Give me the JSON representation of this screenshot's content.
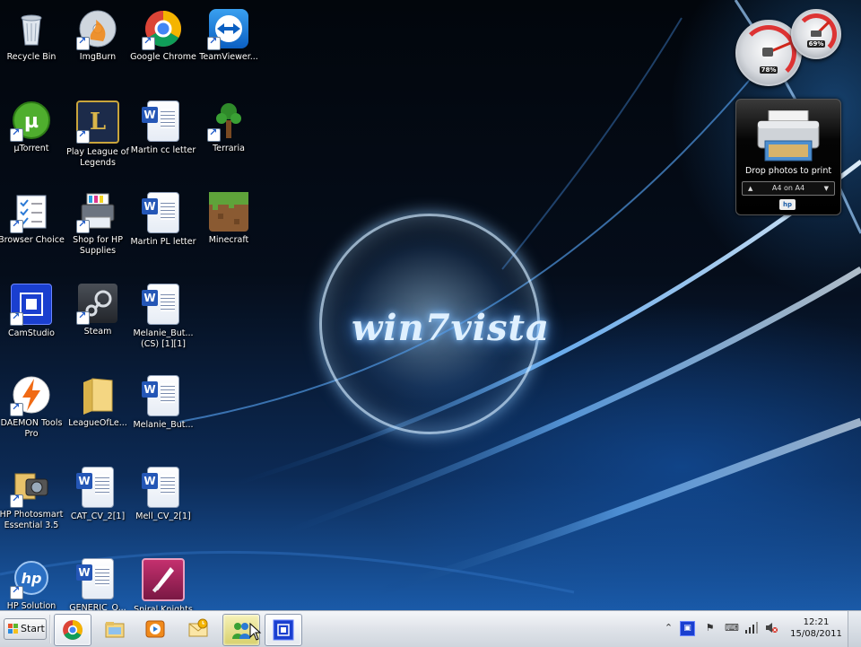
{
  "desktop": {
    "wallpaper_text": "win7vista",
    "icons": [
      {
        "label": "Recycle Bin",
        "icon": "recycle-bin-icon"
      },
      {
        "label": "ImgBurn",
        "icon": "imgburn-icon"
      },
      {
        "label": "Google Chrome",
        "icon": "chrome-icon"
      },
      {
        "label": "TeamViewer...",
        "icon": "teamviewer-icon"
      },
      {
        "label": "µTorrent",
        "icon": "utorrent-icon"
      },
      {
        "label": "Play League of Legends",
        "icon": "league-of-legends-icon"
      },
      {
        "label": "Martin cc letter",
        "icon": "word-document-icon"
      },
      {
        "label": "Terraria",
        "icon": "terraria-icon"
      },
      {
        "label": "Browser Choice",
        "icon": "browser-choice-icon"
      },
      {
        "label": "Shop for HP Supplies",
        "icon": "hp-supplies-icon"
      },
      {
        "label": "Martin PL letter",
        "icon": "word-document-icon"
      },
      {
        "label": "Minecraft",
        "icon": "minecraft-icon"
      },
      {
        "label": "CamStudio",
        "icon": "camstudio-icon"
      },
      {
        "label": "Steam",
        "icon": "steam-icon"
      },
      {
        "label": "Melanie_But... (CS) [1][1]",
        "icon": "word-document-icon"
      },
      {
        "label": "DAEMON Tools Pro",
        "icon": "daemon-tools-icon"
      },
      {
        "label": "LeagueOfLe...",
        "icon": "folder-icon"
      },
      {
        "label": "Melanie_But...",
        "icon": "word-document-icon"
      },
      {
        "label": "HP Photosmart Essential 3.5",
        "icon": "hp-photosmart-icon"
      },
      {
        "label": "CAT_CV_2[1]",
        "icon": "word-document-icon"
      },
      {
        "label": "Mell_CV_2[1]",
        "icon": "word-document-icon"
      },
      {
        "label": "HP Solution",
        "icon": "hp-solution-icon"
      },
      {
        "label": "GENERIC_O...",
        "icon": "word-document-icon"
      },
      {
        "label": "Spiral Knights",
        "icon": "spiral-knights-icon"
      }
    ]
  },
  "gadgets": {
    "cpu_meter": {
      "cpu_percent": "78%",
      "memory_percent": "69%",
      "cpu_value": 78,
      "memory_value": 69
    },
    "printer": {
      "prompt": "Drop photos to print",
      "paper_option": "A4 on A4",
      "brand": "hp"
    }
  },
  "taskbar": {
    "start_label": "Start",
    "buttons": [
      {
        "name": "chrome",
        "active": false
      },
      {
        "name": "windows-explorer",
        "active": false
      },
      {
        "name": "media-player",
        "active": false
      },
      {
        "name": "outlook",
        "active": false
      },
      {
        "name": "msn-messenger",
        "active": true
      },
      {
        "name": "camstudio",
        "active": false
      }
    ],
    "tray": {
      "time": "12:21",
      "date": "15/08/2011"
    }
  }
}
